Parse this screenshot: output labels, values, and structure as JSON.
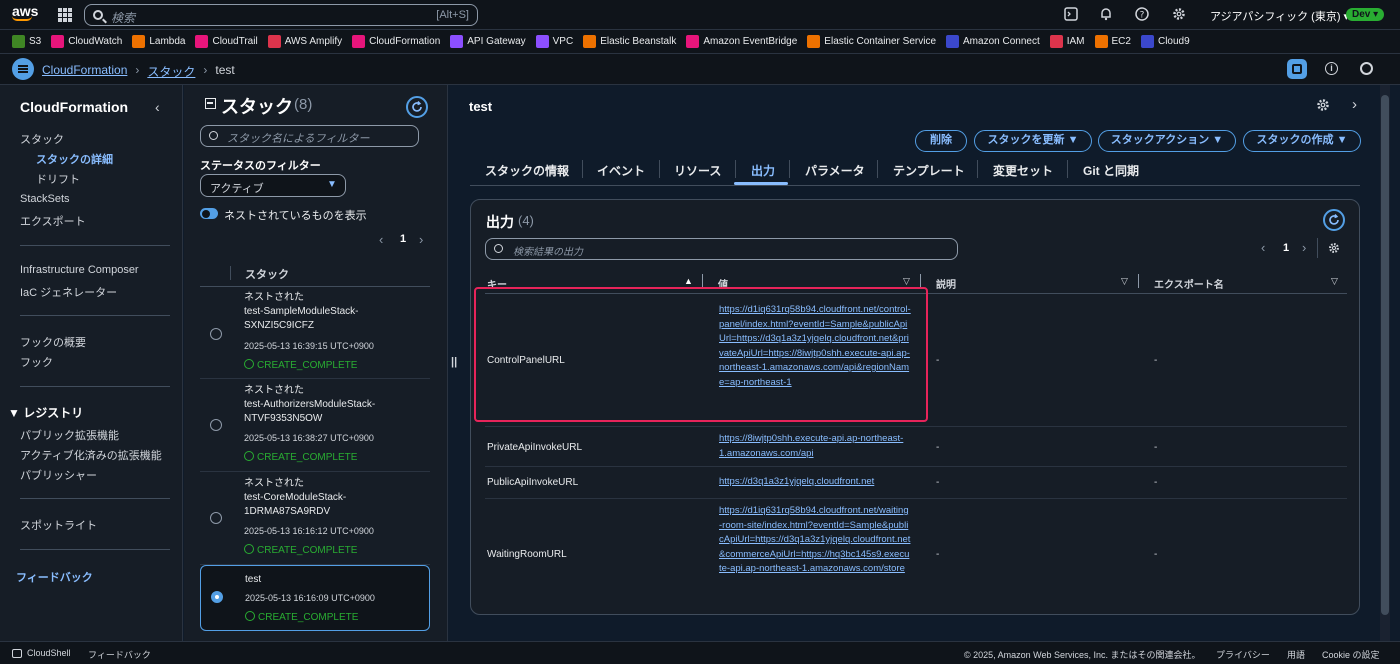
{
  "topbar": {
    "logo": "aws",
    "search_placeholder": "検索",
    "search_shortcut": "[Alt+S]",
    "region": "アジアパシフィック (東京) ▾",
    "account_badge": "Dev ▾"
  },
  "favorites": [
    {
      "label": "S3",
      "color": "#3f8624"
    },
    {
      "label": "CloudWatch",
      "color": "#e7157b"
    },
    {
      "label": "Lambda",
      "color": "#ed7100"
    },
    {
      "label": "CloudTrail",
      "color": "#e7157b"
    },
    {
      "label": "AWS Amplify",
      "color": "#dd344c"
    },
    {
      "label": "CloudFormation",
      "color": "#e7157b"
    },
    {
      "label": "API Gateway",
      "color": "#8c4fff"
    },
    {
      "label": "VPC",
      "color": "#8c4fff"
    },
    {
      "label": "Elastic Beanstalk",
      "color": "#ed7100"
    },
    {
      "label": "Amazon EventBridge",
      "color": "#e7157b"
    },
    {
      "label": "Elastic Container Service",
      "color": "#ed7100"
    },
    {
      "label": "Amazon Connect",
      "color": "#3b48cc"
    },
    {
      "label": "IAM",
      "color": "#dd344c"
    },
    {
      "label": "EC2",
      "color": "#ed7100"
    },
    {
      "label": "Cloud9",
      "color": "#3b48cc"
    }
  ],
  "breadcrumb": {
    "items": [
      "CloudFormation",
      "スタック",
      "test"
    ]
  },
  "leftnav": {
    "title": "CloudFormation",
    "items": {
      "stacks": "スタック",
      "stack_details": "スタックの詳細",
      "drift": "ドリフト",
      "stacksets": "StackSets",
      "exports": "エクスポート",
      "infra_composer": "Infrastructure Composer",
      "iac_generator": "IaC ジェネレーター",
      "hooks_overview": "フックの概要",
      "hooks": "フック",
      "registry": "▼ レジストリ",
      "public_ext": "パブリック拡張機能",
      "activated_ext": "アクティブ化済みの拡張機能",
      "publisher": "パブリッシャー",
      "spotlight": "スポットライト",
      "feedback": "フィードバック"
    }
  },
  "stacks_panel": {
    "title": "スタック",
    "count": "(8)",
    "filter_placeholder": "スタック名によるフィルター",
    "status_filter_label": "ステータスのフィルター",
    "status_filter_value": "アクティブ",
    "nested_toggle_label": "ネストされているものを表示",
    "page": "1",
    "column_header": "スタック",
    "stacks": [
      {
        "prefix": "ネストされた",
        "name": "test-SampleModuleStack-SXNZI5C9ICFZ",
        "time": "2025-05-13 16:39:15 UTC+0900",
        "status": "CREATE_COMPLETE"
      },
      {
        "prefix": "ネストされた",
        "name": "test-AuthorizersModuleStack-NTVF9353N5OW",
        "time": "2025-05-13 16:38:27 UTC+0900",
        "status": "CREATE_COMPLETE"
      },
      {
        "prefix": "ネストされた",
        "name": "test-CoreModuleStack-1DRMA87SA9RDV",
        "time": "2025-05-13 16:16:12 UTC+0900",
        "status": "CREATE_COMPLETE"
      },
      {
        "prefix": "",
        "name": "test",
        "time": "2025-05-13 16:16:09 UTC+0900",
        "status": "CREATE_COMPLETE"
      }
    ]
  },
  "main": {
    "title": "test",
    "buttons": {
      "delete": "削除",
      "update": "スタックを更新 ▼",
      "actions": "スタックアクション ▼",
      "create": "スタックの作成 ▼"
    },
    "tabs": [
      "スタックの情報",
      "イベント",
      "リソース",
      "出力",
      "パラメータ",
      "テンプレート",
      "変更セット",
      "Git と同期"
    ],
    "outputs": {
      "title": "出力",
      "count": "(4)",
      "search_placeholder": "検索結果の出力",
      "page": "1",
      "columns": [
        "キー",
        "値",
        "説明",
        "エクスポート名"
      ],
      "rows": [
        {
          "key": "ControlPanelURL",
          "value": "https://d1iq631rq58b94.cloudfront.net/control-panel/index.html?eventId=Sample&publicApiUrl=https://d3q1a3z1yjqelq.cloudfront.net&privateApiUrl=https://8iwjtp0shh.execute-api.ap-northeast-1.amazonaws.com/api&regionName=ap-northeast-1",
          "description": "-",
          "export": "-"
        },
        {
          "key": "PrivateApiInvokeURL",
          "value": "https://8iwjtp0shh.execute-api.ap-northeast-1.amazonaws.com/api",
          "description": "-",
          "export": "-"
        },
        {
          "key": "PublicApiInvokeURL",
          "value": "https://d3q1a3z1yjqelq.cloudfront.net",
          "description": "-",
          "export": "-"
        },
        {
          "key": "WaitingRoomURL",
          "value": "https://d1iq631rq58b94.cloudfront.net/waiting-room-site/index.html?eventId=Sample&publicApiUrl=https://d3q1a3z1yjqelq.cloudfront.net&commerceApiUrl=https://hq3bc145s9.execute-api.ap-northeast-1.amazonaws.com/store",
          "description": "-",
          "export": "-"
        }
      ]
    }
  },
  "footer": {
    "cloudshell": "CloudShell",
    "feedback": "フィードバック",
    "copyright": "© 2025, Amazon Web Services, Inc. またはその関連会社。",
    "privacy": "プライバシー",
    "terms": "用語",
    "cookie": "Cookie の設定"
  },
  "colors": {
    "accent": "#539fe5",
    "success": "#29ad32",
    "highlight": "#e7245a"
  }
}
